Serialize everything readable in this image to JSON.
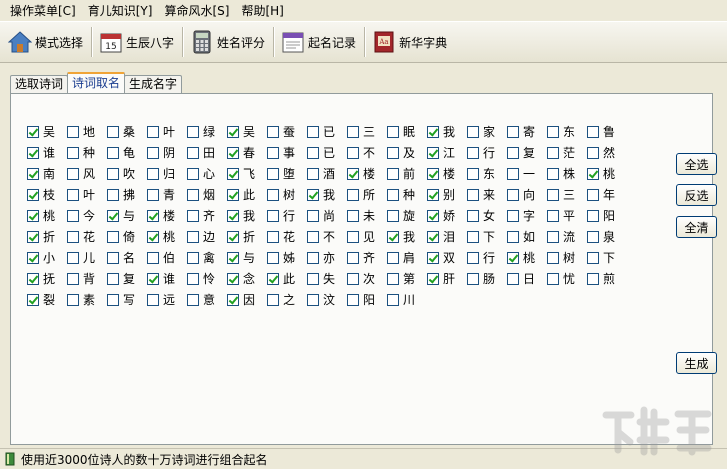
{
  "menu": [
    "操作菜单[C]",
    "育儿知识[Y]",
    "算命风水[S]",
    "帮助[H]"
  ],
  "toolbar": {
    "mode": "模式选择",
    "bazi": "生辰八字",
    "score": "姓名评分",
    "record": "起名记录",
    "dict": "新华字典"
  },
  "tabs": [
    "选取诗词",
    "诗词取名",
    "生成名字"
  ],
  "chars": [
    [
      "吴",
      1
    ],
    [
      "地",
      0
    ],
    [
      "桑",
      0
    ],
    [
      "叶",
      0
    ],
    [
      "绿",
      0
    ],
    [
      "吴",
      1
    ],
    [
      "蚕",
      0
    ],
    [
      "已",
      0
    ],
    [
      "三",
      0
    ],
    [
      "眠",
      0
    ],
    [
      "我",
      1
    ],
    [
      "家",
      0
    ],
    [
      "寄",
      0
    ],
    [
      "东",
      0
    ],
    [
      "鲁",
      0
    ],
    [
      "谁",
      1
    ],
    [
      "种",
      0
    ],
    [
      "龟",
      0
    ],
    [
      "阴",
      0
    ],
    [
      "田",
      0
    ],
    [
      "春",
      1
    ],
    [
      "事",
      0
    ],
    [
      "已",
      0
    ],
    [
      "不",
      0
    ],
    [
      "及",
      0
    ],
    [
      "江",
      1
    ],
    [
      "行",
      0
    ],
    [
      "复",
      0
    ],
    [
      "茫",
      0
    ],
    [
      "然",
      0
    ],
    [
      "南",
      1
    ],
    [
      "风",
      0
    ],
    [
      "吹",
      0
    ],
    [
      "归",
      0
    ],
    [
      "心",
      0
    ],
    [
      "飞",
      1
    ],
    [
      "堕",
      0
    ],
    [
      "酒",
      0
    ],
    [
      "楼",
      1
    ],
    [
      "前",
      0
    ],
    [
      "楼",
      1
    ],
    [
      "东",
      0
    ],
    [
      "一",
      0
    ],
    [
      "株",
      0
    ],
    [
      "桃",
      1
    ],
    [
      "枝",
      1
    ],
    [
      "叶",
      0
    ],
    [
      "拂",
      0
    ],
    [
      "青",
      0
    ],
    [
      "烟",
      0
    ],
    [
      "此",
      1
    ],
    [
      "树",
      0
    ],
    [
      "我",
      1
    ],
    [
      "所",
      0
    ],
    [
      "种",
      0
    ],
    [
      "别",
      1
    ],
    [
      "来",
      0
    ],
    [
      "向",
      0
    ],
    [
      "三",
      0
    ],
    [
      "年",
      0
    ],
    [
      "桃",
      1
    ],
    [
      "今",
      0
    ],
    [
      "与",
      1
    ],
    [
      "楼",
      1
    ],
    [
      "齐",
      0
    ],
    [
      "我",
      1
    ],
    [
      "行",
      0
    ],
    [
      "尚",
      0
    ],
    [
      "未",
      0
    ],
    [
      "旋",
      0
    ],
    [
      "娇",
      1
    ],
    [
      "女",
      0
    ],
    [
      "字",
      0
    ],
    [
      "平",
      0
    ],
    [
      "阳",
      0
    ],
    [
      "折",
      1
    ],
    [
      "花",
      0
    ],
    [
      "倚",
      0
    ],
    [
      "桃",
      1
    ],
    [
      "边",
      0
    ],
    [
      "折",
      1
    ],
    [
      "花",
      0
    ],
    [
      "不",
      0
    ],
    [
      "见",
      0
    ],
    [
      "我",
      1
    ],
    [
      "泪",
      1
    ],
    [
      "下",
      0
    ],
    [
      "如",
      0
    ],
    [
      "流",
      0
    ],
    [
      "泉",
      0
    ],
    [
      "小",
      1
    ],
    [
      "儿",
      0
    ],
    [
      "名",
      0
    ],
    [
      "伯",
      0
    ],
    [
      "禽",
      0
    ],
    [
      "与",
      1
    ],
    [
      "姊",
      0
    ],
    [
      "亦",
      0
    ],
    [
      "齐",
      0
    ],
    [
      "肩",
      0
    ],
    [
      "双",
      1
    ],
    [
      "行",
      0
    ],
    [
      "桃",
      1
    ],
    [
      "树",
      0
    ],
    [
      "下",
      0
    ],
    [
      "抚",
      1
    ],
    [
      "背",
      0
    ],
    [
      "复",
      0
    ],
    [
      "谁",
      1
    ],
    [
      "怜",
      0
    ],
    [
      "念",
      1
    ],
    [
      "此",
      1
    ],
    [
      "失",
      0
    ],
    [
      "次",
      0
    ],
    [
      "第",
      0
    ],
    [
      "肝",
      1
    ],
    [
      "肠",
      0
    ],
    [
      "日",
      0
    ],
    [
      "忧",
      0
    ],
    [
      "煎",
      0
    ],
    [
      "裂",
      1
    ],
    [
      "素",
      0
    ],
    [
      "写",
      0
    ],
    [
      "远",
      0
    ],
    [
      "意",
      0
    ],
    [
      "因",
      1
    ],
    [
      "之",
      0
    ],
    [
      "汶",
      0
    ],
    [
      "阳",
      0
    ],
    [
      "川",
      0
    ]
  ],
  "buttons": {
    "select_all": "全选",
    "invert": "反选",
    "clear_all": "全清",
    "generate": "生成"
  },
  "status": "使用近3000位诗人的数十万诗词进行组合起名",
  "colors": {
    "checkmark": "#21a121",
    "tab_accent": "#f0a436",
    "background": "#ece9d8"
  }
}
